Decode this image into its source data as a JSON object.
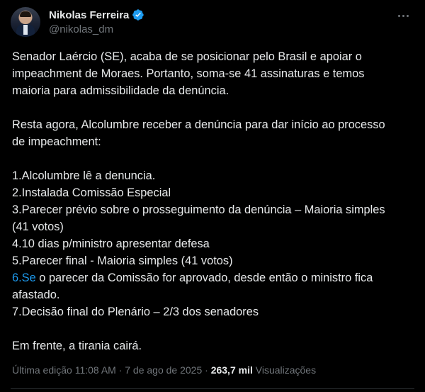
{
  "author": {
    "name": "Nikolas Ferreira",
    "handle": "@nikolas_dm",
    "verified": true
  },
  "tweet": {
    "paragraph1": [
      "Senador Laércio (SE), acaba de se posicionar pelo Brasil e apoiar o",
      "impeachment de Moraes. Portanto, soma-se 41 assinaturas e temos",
      "maioria para admissibilidade da denúncia."
    ],
    "paragraph2": [
      "Resta agora, Alcolumbre receber a denúncia para dar início ao processo",
      "de impeachment:"
    ],
    "list": {
      "item1": "1.Alcolumbre lê a denuncia.",
      "item2": "2.Instalada Comissão Especial",
      "item3a": "3.Parecer prévio sobre o prosseguimento da denúncia – Maioria simples",
      "item3b": "(41 votos)",
      "item4": "4.10 dias p/ministro apresentar defesa",
      "item5": "5.Parecer final - Maioria simples (41 votos)",
      "item6_link": "6.Se",
      "item6a_rest": " o parecer da Comissão for aprovado, desde então o ministro fica",
      "item6b": "afastado.",
      "item7": "7.Decisão final do Plenário – 2/3 dos senadores"
    },
    "closing": "Em frente, a tirania cairá."
  },
  "meta": {
    "edited": "Última edição 11:08 AM · 7 de ago de 2025 · ",
    "views_count": "263,7 mil",
    "views_label": " Visualizações"
  },
  "colors": {
    "background": "#000000",
    "text": "#e7e9ea",
    "muted": "#71767b",
    "link": "#1d9bf0",
    "verified": "#1d9bf0"
  },
  "icons": {
    "verified": "verified-badge-icon",
    "more": "more-options-icon"
  }
}
